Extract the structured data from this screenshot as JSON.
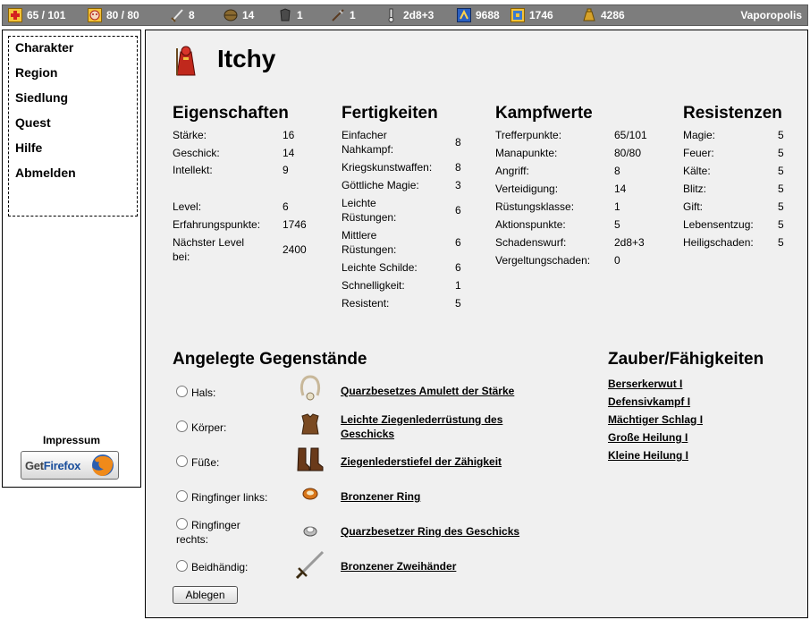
{
  "topbar": {
    "stats": [
      {
        "icon": "health-cross-icon",
        "value": "65 / 101"
      },
      {
        "icon": "mana-face-icon",
        "value": "80 / 80"
      },
      {
        "icon": "sword-attack-icon",
        "value": "8"
      },
      {
        "icon": "shield-defense-icon",
        "value": "14"
      },
      {
        "icon": "armor-class-icon",
        "value": "1"
      },
      {
        "icon": "action-points-icon",
        "value": "1"
      },
      {
        "icon": "damage-roll-icon",
        "value": "2d8+3"
      },
      {
        "icon": "experience-icon",
        "value": "9688"
      },
      {
        "icon": "next-level-icon",
        "value": "1746"
      },
      {
        "icon": "gold-bag-icon",
        "value": "4286"
      }
    ],
    "world": "Vaporopolis"
  },
  "nav": {
    "items": [
      "Charakter",
      "Region",
      "Siedlung",
      "Quest",
      "Hilfe",
      "Abmelden"
    ],
    "impressum": "Impressum",
    "firefox_get": "Get",
    "firefox_name": "Firefox"
  },
  "character": {
    "name": "Itchy"
  },
  "eigenschaften": {
    "title": "Eigenschaften",
    "rows": [
      {
        "label": "Stärke:",
        "value": "16"
      },
      {
        "label": "Geschick:",
        "value": "14"
      },
      {
        "label": "Intellekt:",
        "value": "9"
      },
      {
        "label": "Level:",
        "value": "6"
      },
      {
        "label": "Erfahrungspunkte:",
        "value": "1746"
      },
      {
        "label": "Nächster Level bei:",
        "value": "2400"
      }
    ]
  },
  "fertigkeiten": {
    "title": "Fertigkeiten",
    "rows": [
      {
        "label": "Einfacher Nahkampf:",
        "value": "8"
      },
      {
        "label": "Kriegskunstwaffen:",
        "value": "8"
      },
      {
        "label": "Göttliche Magie:",
        "value": "3"
      },
      {
        "label": "Leichte Rüstungen:",
        "value": "6"
      },
      {
        "label": "Mittlere Rüstungen:",
        "value": "6"
      },
      {
        "label": "Leichte Schilde:",
        "value": "6"
      },
      {
        "label": "Schnelligkeit:",
        "value": "1"
      },
      {
        "label": "Resistent:",
        "value": "5"
      }
    ]
  },
  "kampfwerte": {
    "title": "Kampfwerte",
    "rows": [
      {
        "label": "Trefferpunkte:",
        "value": "65/101"
      },
      {
        "label": "Manapunkte:",
        "value": "80/80"
      },
      {
        "label": "Angriff:",
        "value": "8"
      },
      {
        "label": "Verteidigung:",
        "value": "14"
      },
      {
        "label": "Rüstungsklasse:",
        "value": "1"
      },
      {
        "label": "Aktionspunkte:",
        "value": "5"
      },
      {
        "label": "Schadenswurf:",
        "value": "2d8+3"
      },
      {
        "label": "Vergeltungschaden:",
        "value": "0"
      }
    ]
  },
  "resistenzen": {
    "title": "Resistenzen",
    "rows": [
      {
        "label": "Magie:",
        "value": "5"
      },
      {
        "label": "Feuer:",
        "value": "5"
      },
      {
        "label": "Kälte:",
        "value": "5"
      },
      {
        "label": "Blitz:",
        "value": "5"
      },
      {
        "label": "Gift:",
        "value": "5"
      },
      {
        "label": "Lebensentzug:",
        "value": "5"
      },
      {
        "label": "Heiligschaden:",
        "value": "5"
      }
    ]
  },
  "equipment": {
    "title": "Angelegte Gegenstände",
    "slots": [
      {
        "slot": "Hals:",
        "item": "Quarzbesetzes Amulett der Stärke",
        "icon": "amulet-icon"
      },
      {
        "slot": "Körper:",
        "item": "Leichte Ziegenlederrüstung des Geschicks",
        "icon": "leather-armor-icon"
      },
      {
        "slot": "Füße:",
        "item": "Ziegenlederstiefel der Zähigkeit",
        "icon": "boots-icon"
      },
      {
        "slot": "Ringfinger links:",
        "item": "Bronzener Ring",
        "icon": "bronze-ring-icon"
      },
      {
        "slot": "Ringfinger rechts:",
        "item": "Quarzbesetzer Ring des Geschicks",
        "icon": "quartz-ring-icon"
      },
      {
        "slot": "Beidhändig:",
        "item": "Bronzener Zweihänder",
        "icon": "two-handed-sword-icon"
      }
    ],
    "button": "Ablegen"
  },
  "spells": {
    "title": "Zauber/Fähigkeiten",
    "items": [
      "Berserkerwut I",
      "Defensivkampf I",
      "Mächtiger Schlag I",
      "Große Heilung I",
      "Kleine Heilung I"
    ]
  }
}
